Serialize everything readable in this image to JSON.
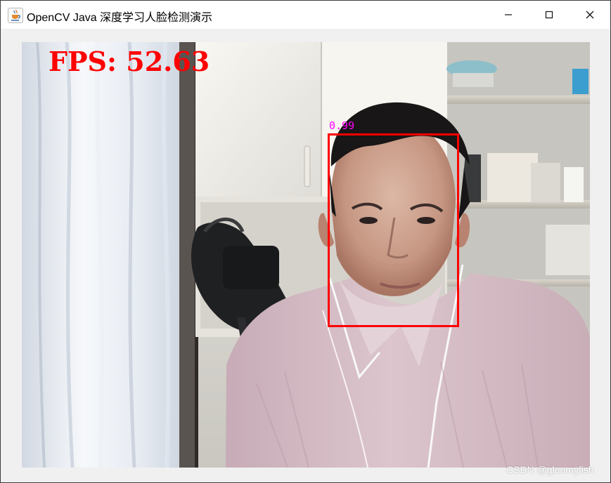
{
  "window": {
    "title": "OpenCV Java 深度学习人脸检测演示",
    "app_icon": "java-coffee-cup-icon",
    "controls": {
      "minimize_icon": "minimize-icon",
      "maximize_icon": "maximize-icon",
      "close_icon": "close-icon"
    }
  },
  "video": {
    "fps_text": "FPS: 52.63",
    "detection": {
      "confidence": "0.99"
    }
  },
  "watermark": "CSDN @gloomyfish",
  "colors": {
    "fps_text": "#ff0000",
    "detection_box": "#ff0000",
    "confidence_text": "#ff00ff",
    "window_background": "#f0f0f0",
    "titlebar_background": "#ffffff"
  }
}
